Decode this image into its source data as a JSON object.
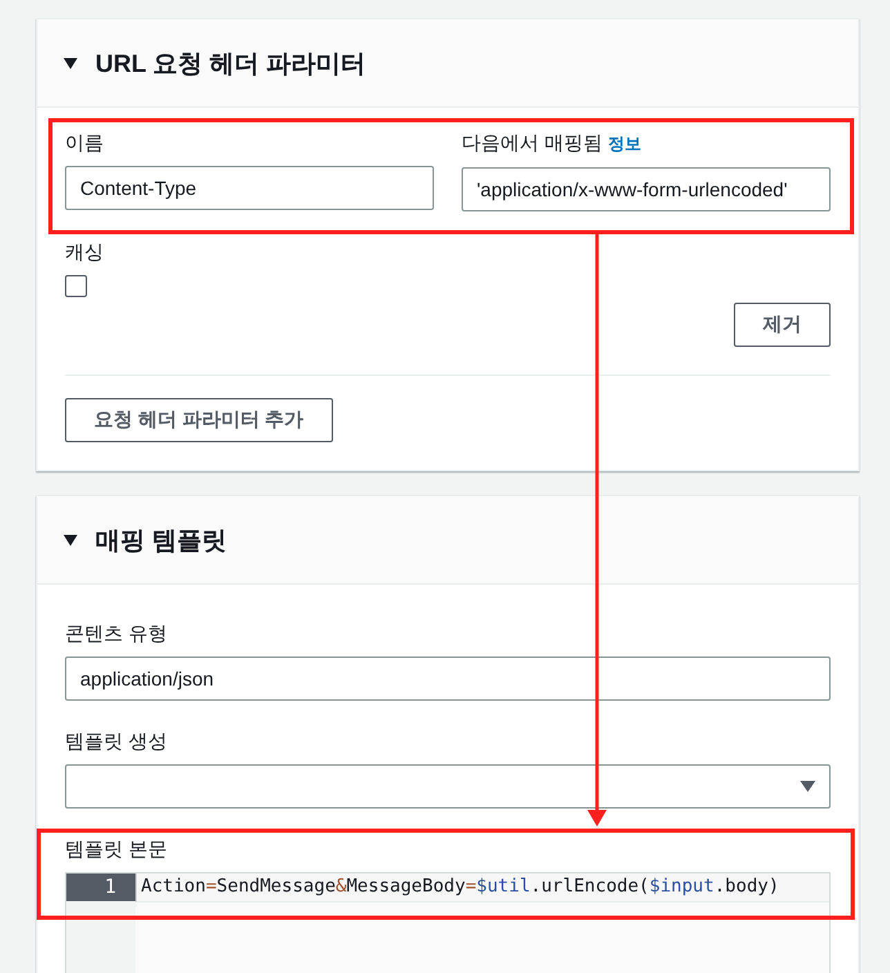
{
  "header_section": {
    "title": "URL 요청 헤더 파라미터",
    "expanded": true,
    "parameter": {
      "name_label": "이름",
      "name_value": "Content-Type",
      "mapped_label": "다음에서 매핑됨",
      "info_link": "정보",
      "mapped_value": "'application/x-www-form-urlencoded'",
      "caching_label": "캐싱",
      "caching_checked": false,
      "remove_button": "제거"
    },
    "add_button": "요청 헤더 파라미터 추가"
  },
  "mapping_section": {
    "title": "매핑 템플릿",
    "expanded": true,
    "content_type_label": "콘텐츠 유형",
    "content_type_value": "application/json",
    "generate_label": "템플릿 생성",
    "body_label": "템플릿 본문",
    "code_lines": [
      {
        "number": "1",
        "tokens": [
          {
            "text": "Action",
            "kind": "plain"
          },
          {
            "text": "=",
            "kind": "operator"
          },
          {
            "text": "SendMessage",
            "kind": "plain"
          },
          {
            "text": "&",
            "kind": "operator"
          },
          {
            "text": "MessageBody",
            "kind": "plain"
          },
          {
            "text": "=",
            "kind": "operator"
          },
          {
            "text": "$util",
            "kind": "variable"
          },
          {
            "text": ".urlEncode(",
            "kind": "plain"
          },
          {
            "text": "$input",
            "kind": "variable"
          },
          {
            "text": ".body)",
            "kind": "plain"
          }
        ]
      }
    ]
  }
}
